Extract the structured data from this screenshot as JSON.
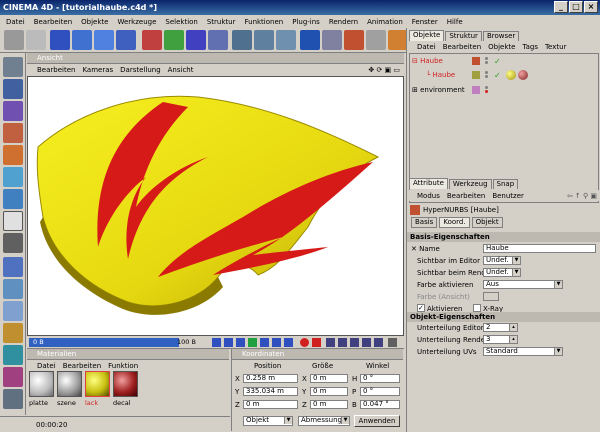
{
  "title": "CINEMA 4D - [tutorialhaube.c4d *]",
  "window_buttons": [
    "_",
    "□",
    "×"
  ],
  "menu": [
    "Datei",
    "Bearbeiten",
    "Objekte",
    "Werkzeuge",
    "Selektion",
    "Struktur",
    "Funktionen",
    "Plug-ins",
    "Rendern",
    "Animation",
    "Fenster",
    "Hilfe"
  ],
  "viewport": {
    "title": "Ansicht",
    "menu": [
      "Bearbeiten",
      "Kameras",
      "Darstellung",
      "Ansicht"
    ],
    "nav_icons": "✥ ⟳ ▣ ▭"
  },
  "timeline": {
    "frame": "0 B",
    "end": "100 B"
  },
  "materials": {
    "title": "Materialien",
    "menu": [
      "Datei",
      "Bearbeiten",
      "Funktion"
    ],
    "items": [
      {
        "label": "platte",
        "color": "#ffffff"
      },
      {
        "label": "szene",
        "color": "#e0e0e0"
      },
      {
        "label": "lack",
        "color": "#e8e020"
      },
      {
        "label": "decal",
        "color": "#b02020"
      }
    ]
  },
  "coords": {
    "title": "Koordinaten",
    "col_position": "Position",
    "col_size": "Größe",
    "col_angle": "Winkel",
    "rows": [
      {
        "axis": "X",
        "pos": "0.258 m",
        "size_axis": "X",
        "size": "0 m",
        "angle_axis": "H",
        "angle": "0 °"
      },
      {
        "axis": "Y",
        "pos": "335.034 m",
        "size_axis": "Y",
        "size": "0 m",
        "angle_axis": "P",
        "angle": "0 °"
      },
      {
        "axis": "Z",
        "pos": "0 m",
        "size_axis": "Z",
        "size": "0 m",
        "angle_axis": "B",
        "angle": "0.047 °"
      }
    ],
    "mode": "Objekt",
    "size_mode": "Abmessung",
    "apply": "Anwenden"
  },
  "status": {
    "time": "00:00:20"
  },
  "objects_panel": {
    "tabs": [
      "Objekte",
      "Struktur",
      "Browser"
    ],
    "menu": [
      "Datei",
      "Bearbeiten",
      "Objekte",
      "Tags",
      "Textur"
    ],
    "tree": [
      {
        "label": "Haube",
        "indent": 0
      },
      {
        "label": "Haube",
        "indent": 1
      },
      {
        "label": "environment",
        "indent": 0
      }
    ]
  },
  "attr_panel": {
    "tabs": [
      "Attribute",
      "Werkzeug",
      "Snap"
    ],
    "menu": [
      "Modus",
      "Bearbeiten",
      "Benutzer"
    ],
    "object_title": "HyperNURBS [Haube]",
    "subtabs": [
      "Basis",
      "Koord.",
      "Objekt"
    ],
    "basis_header": "Basis-Eigenschaften",
    "name_label": "Name",
    "name_value": "Haube",
    "editor_label": "Sichtbar im Editor",
    "editor_value": "Undef.",
    "render_label": "Sichtbar beim Rendern",
    "render_value": "Undef.",
    "color_label": "Farbe aktivieren",
    "color_value": "Aus",
    "color_disp_label": "Farbe (Ansicht)",
    "activate_label": "Aktivieren",
    "xray_label": "X-Ray",
    "obj_header": "Objekt-Eigenschaften",
    "sub_editor_label": "Unterteilung Editor",
    "sub_editor_value": "2",
    "sub_render_label": "Unterteilung Renderer",
    "sub_render_value": "3",
    "sub_uv_label": "Unterteilung UVs",
    "sub_uv_value": "Standard"
  }
}
